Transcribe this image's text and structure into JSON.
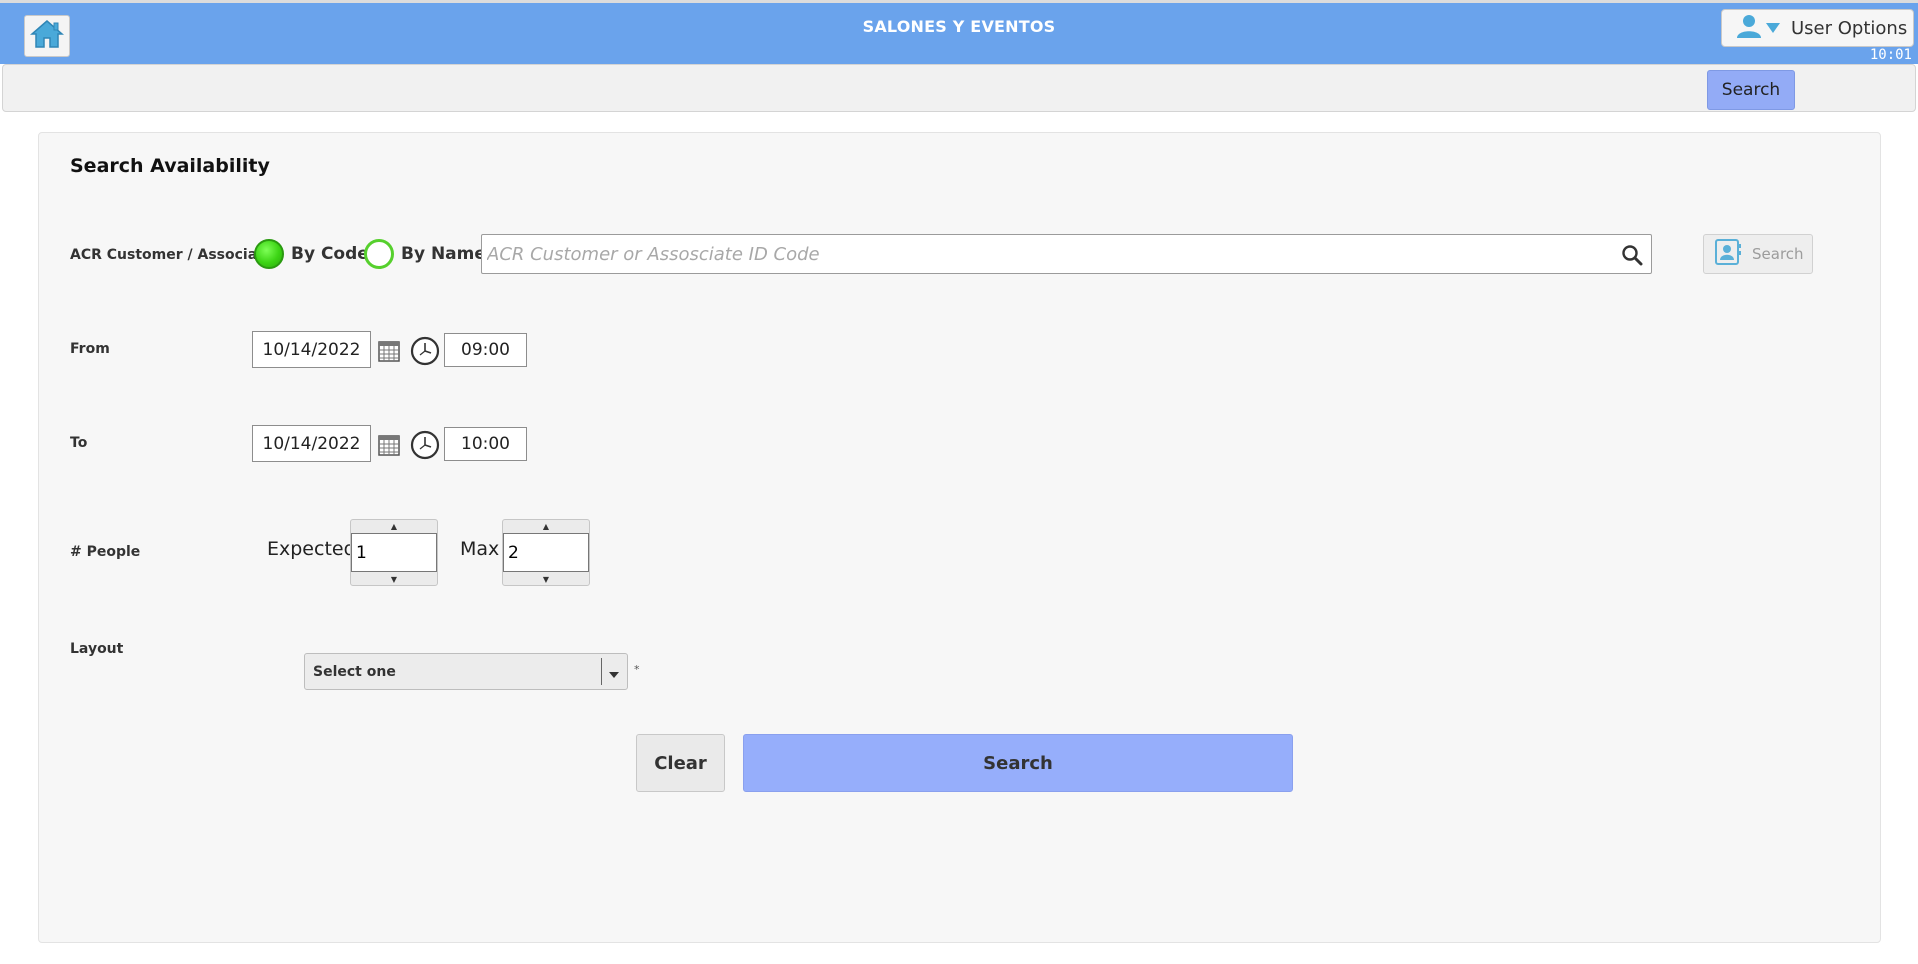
{
  "header": {
    "title": "SALONES Y EVENTOS",
    "user_options_label": "User Options",
    "clock": "10:01"
  },
  "toolbar": {
    "search_label": "Search"
  },
  "form": {
    "title": "Search Availability",
    "customer": {
      "label": "ACR Customer / Associate",
      "option_by_code": "By Code",
      "option_by_name": "By Name",
      "selected": "By Code",
      "placeholder": "ACR Customer or Assosciate ID Code",
      "value": "",
      "search_label": "Search"
    },
    "from": {
      "label": "From",
      "date": "10/14/2022",
      "time": "09:00"
    },
    "to": {
      "label": "To",
      "date": "10/14/2022",
      "time": "10:00"
    },
    "people": {
      "label": "# People",
      "expected_label": "Expected",
      "expected_value": "1",
      "max_label": "Max",
      "max_value": "2"
    },
    "layout": {
      "label": "Layout",
      "selected": "Select one",
      "required_mark": "*"
    },
    "actions": {
      "clear_label": "Clear",
      "search_label": "Search"
    }
  },
  "colors": {
    "header_bg": "#6aa3ec",
    "primary_button": "#96aefb",
    "radio_on": "#3cd414"
  }
}
